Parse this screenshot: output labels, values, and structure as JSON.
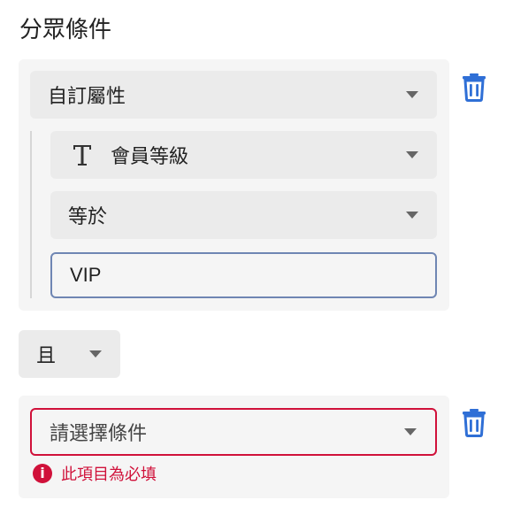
{
  "title": "分眾條件",
  "condition1": {
    "type_select": "自訂屬性",
    "field_select": "會員等級",
    "field_icon": "text-type-icon",
    "operator_select": "等於",
    "value_input": "VIP",
    "delete_icon": "trash-icon"
  },
  "logic_select": "且",
  "condition2": {
    "select_placeholder": "請選擇條件",
    "error_message": "此項目為必填",
    "error_icon": "error-circle-icon",
    "delete_icon": "trash-icon"
  },
  "colors": {
    "accent_blue": "#2f6fd6",
    "error_red": "#d0113a",
    "input_border": "#6f86b3"
  }
}
